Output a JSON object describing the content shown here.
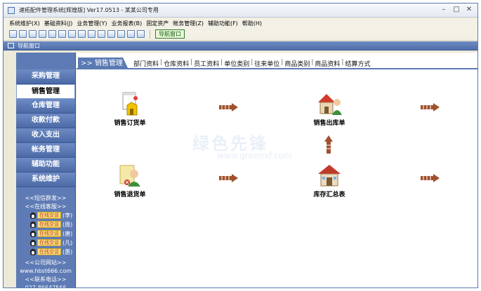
{
  "window": {
    "title": "速拓配件管理系统[辉煌版] Ver17.0513  -  某某公司专用",
    "controls": [
      "–",
      "□",
      "✕"
    ]
  },
  "menu": [
    "系统维护(X)",
    "基础资料(J)",
    "业务管理(Y)",
    "业务报表(B)",
    "固定资产",
    "帐务管理(Z)",
    "辅助功能(F)",
    "帮助(H)"
  ],
  "toolbar": {
    "nav_window_label": "导航窗口"
  },
  "nav_panel": {
    "title": "导航窗口"
  },
  "sidebar": {
    "items": [
      {
        "label": "采购管理",
        "active": false
      },
      {
        "label": "销售管理",
        "active": true
      },
      {
        "label": "仓库管理",
        "active": false
      },
      {
        "label": "收款付款",
        "active": false
      },
      {
        "label": "收入支出",
        "active": false
      },
      {
        "label": "帐务管理",
        "active": false
      },
      {
        "label": "辅助功能",
        "active": false
      },
      {
        "label": "系统维护",
        "active": false
      }
    ],
    "sms_link": "<<短信群发>>",
    "online_service": "<<在线客服>>",
    "qq_badge": "在线交谈",
    "qq_contacts": [
      "(李)",
      "(周)",
      "(唐)",
      "(凡)",
      "(惠)"
    ],
    "website_title": "<<公司网站>>",
    "website_url": "www.hbst666.com",
    "phone_title": "<<联系电话>>",
    "phone_partial": "027-86647566"
  },
  "content": {
    "active_tab": ">> 销售管理",
    "tab_links": [
      "部门资料",
      "仓库资料",
      "员工资料",
      "单位类别",
      "往来单位",
      "商品类别",
      "商品资料",
      "结算方式"
    ],
    "modules": {
      "sales_order": "销售订货单",
      "sales_outbound": "销售出库单",
      "sales_return": "销售退货单",
      "inventory_summary": "库存汇总表"
    },
    "watermark": "绿色先锋",
    "watermark_sub": "www.greenxf.com"
  },
  "colors": {
    "sidebar_bg": "#5e7bb5",
    "accent_blue": "#5b7ab4",
    "arrow_brown": "#a0522d",
    "nav_button_green": "#2c7a2c"
  }
}
